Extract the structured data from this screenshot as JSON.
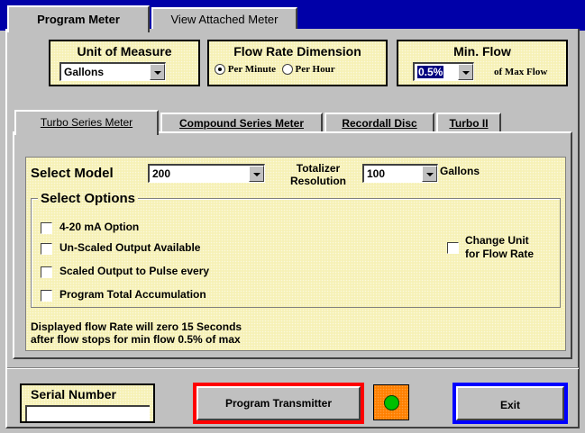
{
  "tabs": {
    "program_meter": "Program Meter",
    "view_attached_meter": "View Attached Meter"
  },
  "unit_of_measure": {
    "title": "Unit of Measure",
    "value": "Gallons"
  },
  "flow_rate_dimension": {
    "title": "Flow Rate Dimension",
    "per_minute": "Per Minute",
    "per_hour": "Per Hour",
    "selected": "Per Minute"
  },
  "min_flow": {
    "title": "Min. Flow",
    "value": "0.5%",
    "suffix": "of Max Flow"
  },
  "meter_tabs": {
    "turbo_series": "Turbo Series Meter",
    "compound_series": "Compound Series Meter",
    "recordall_disc": "Recordall Disc",
    "turbo_ii": "Turbo II"
  },
  "model": {
    "label": "Select Model",
    "value": "200"
  },
  "totalizer": {
    "label_line1": "Totalizer",
    "label_line2": "Resolution",
    "value": "100",
    "unit": "Gallons"
  },
  "options": {
    "title": "Select Options",
    "items": [
      "4-20 mA Option",
      "Un-Scaled Output Available",
      "Scaled Output to Pulse every",
      "Program Total Accumulation"
    ],
    "change_unit_line1": "Change Unit",
    "change_unit_line2": "for Flow Rate"
  },
  "info": {
    "line1": "Displayed flow Rate will zero 15 Seconds",
    "line2": "after flow stops for min flow 0.5%  of max"
  },
  "serial_number": {
    "label": "Serial Number",
    "value": ""
  },
  "buttons": {
    "program_transmitter": "Program Transmitter",
    "exit": "Exit"
  },
  "colors": {
    "title_bar": "#0000a8",
    "panel_yellow": "#f6f1b6",
    "program_border": "#ff0000",
    "exit_border": "#0000ff",
    "status_led": "#00c000",
    "led_frame": "#ff8000"
  }
}
